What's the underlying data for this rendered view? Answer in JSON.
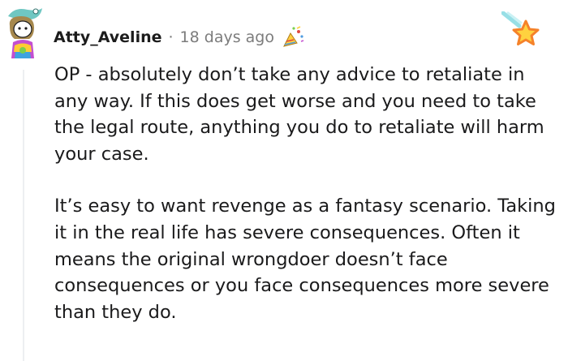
{
  "comment": {
    "username": "Atty_Aveline",
    "separator": "·",
    "timestamp": "18 days ago",
    "paragraphs": [
      "OP - absolutely don’t take any advice to retaliate in any way. If this does get worse and you need to take the legal route, anything you do to retaliate will harm your case.",
      "It’s easy to want revenge as a fantasy scenario. Taking it in the real life has severe consequences. Often it means the original wrongdoer doesn’t face consequences or you face consequences more severe than they do."
    ]
  },
  "icons": {
    "avatar": "snoo-avatar-icon",
    "time_award": "party-award-icon",
    "corner_award": "shooting-star-award-icon"
  },
  "colors": {
    "text": "#1a1a1b",
    "meta": "#7c7c7c",
    "thread_line": "#edeff1",
    "star_orange": "#f5822a",
    "star_yellow": "#ffd23f"
  }
}
